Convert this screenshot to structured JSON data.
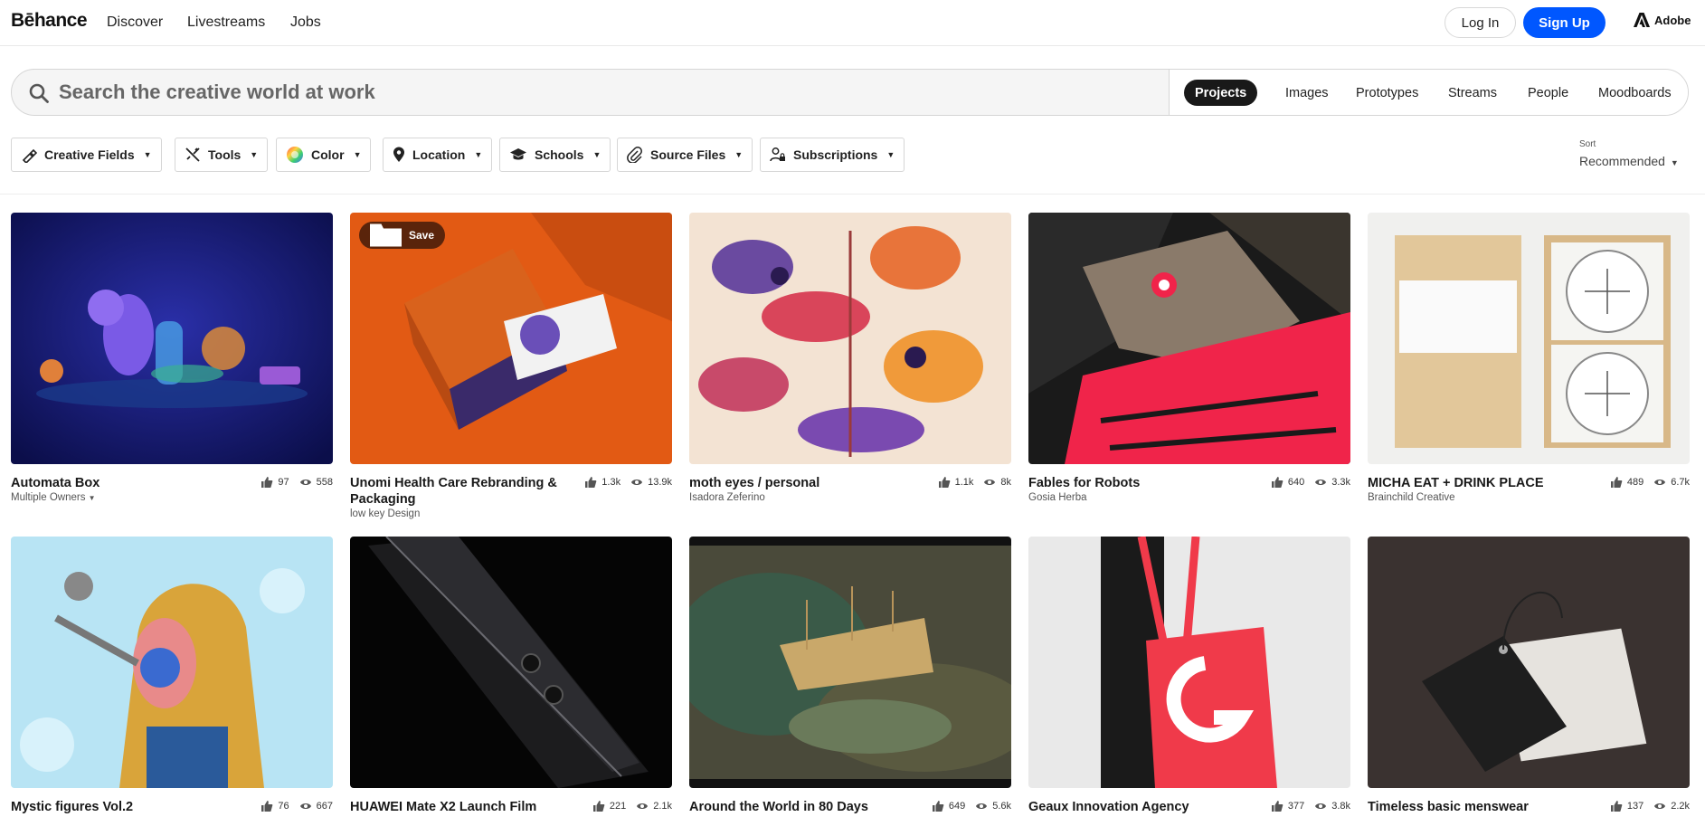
{
  "brand": {
    "logo": "Bēhance",
    "adobe_label": "Adobe",
    "accent": "#0057ff"
  },
  "nav": {
    "discover": "Discover",
    "livestreams": "Livestreams",
    "jobs": "Jobs"
  },
  "auth": {
    "login": "Log In",
    "signup": "Sign Up"
  },
  "search": {
    "placeholder": "Search the creative world at work",
    "tabs": [
      "Projects",
      "Images",
      "Prototypes",
      "Streams",
      "People",
      "Moodboards"
    ],
    "active_tab": "Projects"
  },
  "filters": [
    "Creative Fields",
    "Tools",
    "Color",
    "Location",
    "Schools",
    "Source Files",
    "Subscriptions"
  ],
  "sort": {
    "label": "Sort",
    "value": "Recommended"
  },
  "projects": [
    {
      "title": "Automata Box",
      "owner": "Multiple Owners",
      "likes": "97",
      "views": "558",
      "has_dropdown": true
    },
    {
      "title": "Unomi Health Care Rebranding & Packaging",
      "owner": "low key Design",
      "likes": "1.3k",
      "views": "13.9k",
      "save_label": "Save"
    },
    {
      "title": "moth eyes / personal",
      "owner": "Isadora Zeferino",
      "likes": "1.1k",
      "views": "8k"
    },
    {
      "title": "Fables for Robots",
      "owner": "Gosia Herba",
      "likes": "640",
      "views": "3.3k"
    },
    {
      "title": "MICHA EAT + DRINK PLACE",
      "owner": "Brainchild Creative",
      "likes": "489",
      "views": "6.7k"
    },
    {
      "title": "Mystic figures Vol.2",
      "owner": "",
      "likes": "76",
      "views": "667"
    },
    {
      "title": "HUAWEI Mate X2 Launch Film",
      "owner": "",
      "likes": "221",
      "views": "2.1k"
    },
    {
      "title": "Around the World in 80 Days",
      "owner": "",
      "likes": "649",
      "views": "5.6k"
    },
    {
      "title": "Geaux Innovation Agency",
      "owner": "",
      "likes": "377",
      "views": "3.8k"
    },
    {
      "title": "Timeless basic menswear",
      "owner": "",
      "likes": "137",
      "views": "2.2k"
    }
  ]
}
